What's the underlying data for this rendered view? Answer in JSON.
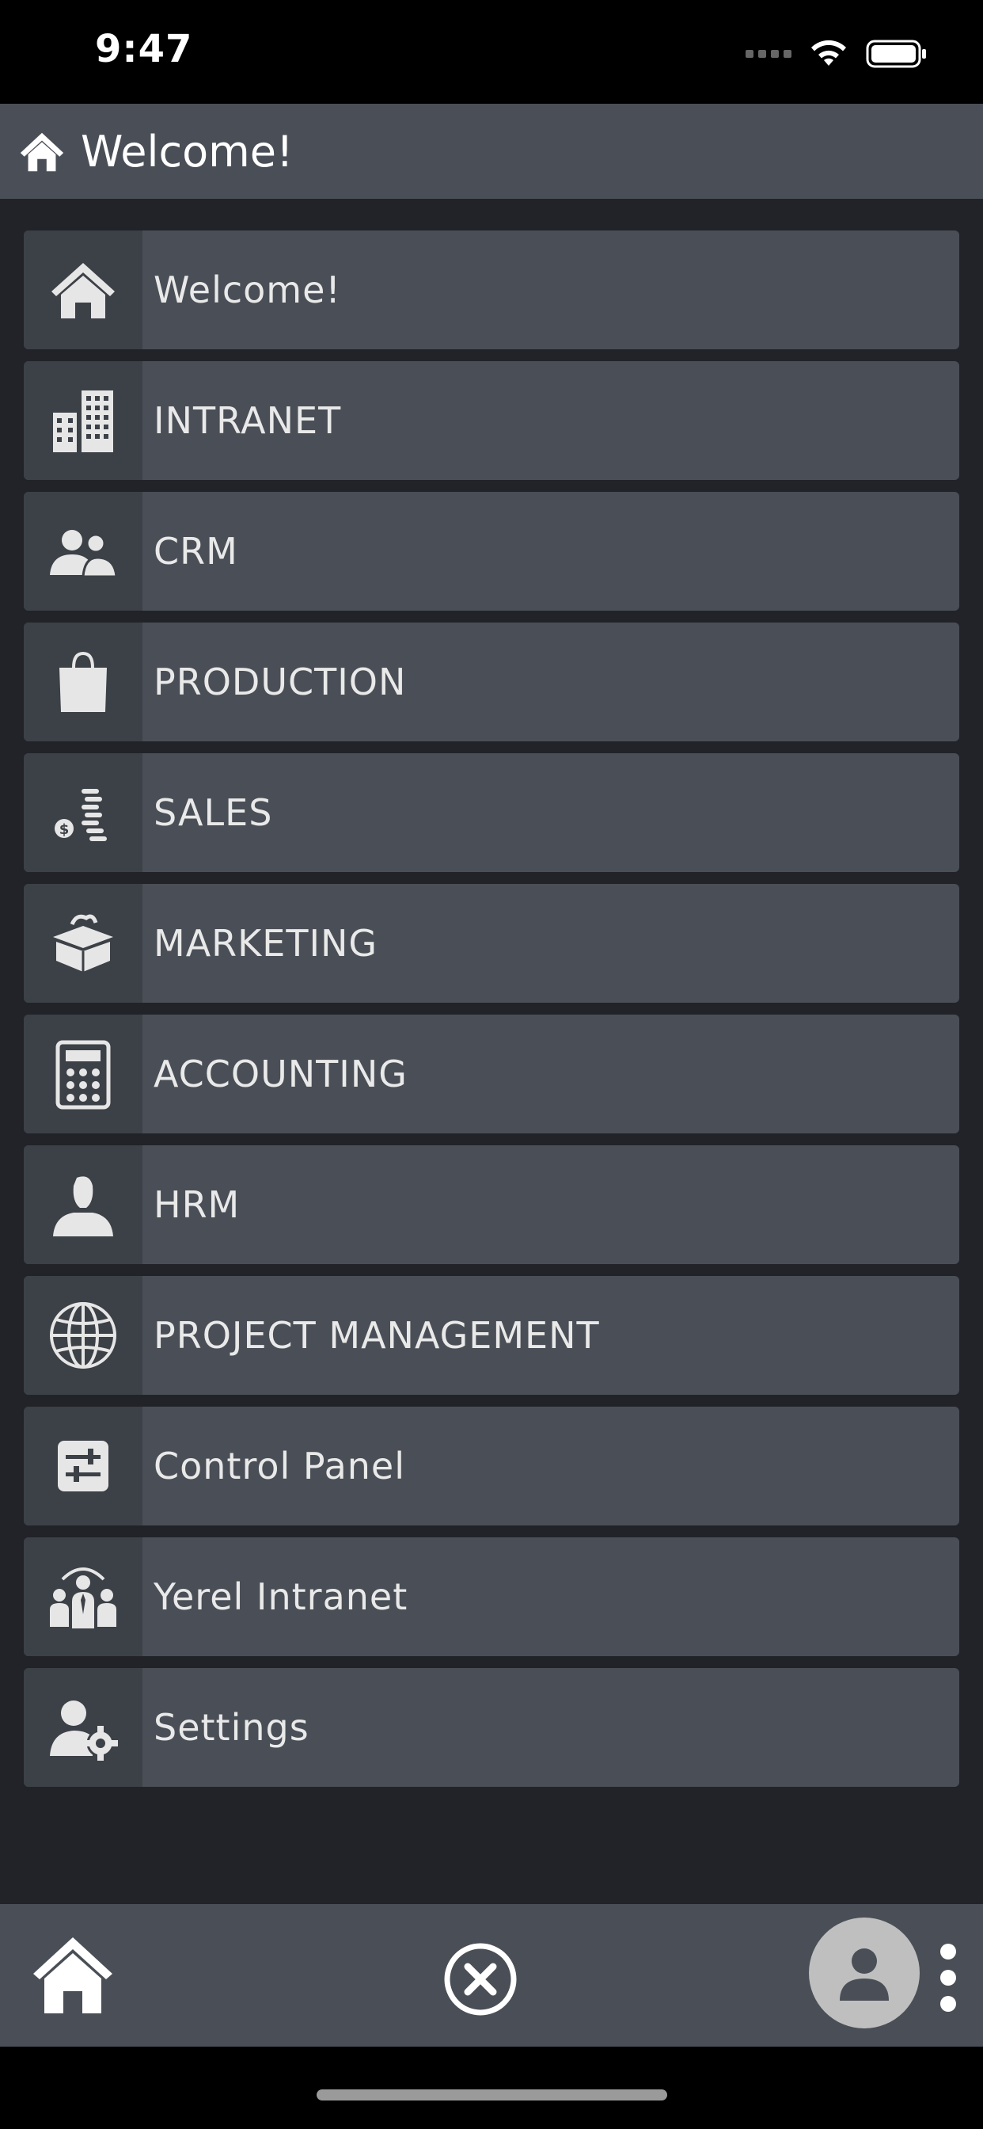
{
  "status_bar": {
    "time": "9:47"
  },
  "header": {
    "title": "Welcome!",
    "icon": "home-icon"
  },
  "menu": {
    "items": [
      {
        "label": "Welcome!",
        "icon": "home-icon"
      },
      {
        "label": "INTRANET",
        "icon": "buildings-icon"
      },
      {
        "label": "CRM",
        "icon": "people-icon"
      },
      {
        "label": "PRODUCTION",
        "icon": "shopping-bag-icon"
      },
      {
        "label": "SALES",
        "icon": "coins-icon"
      },
      {
        "label": "MARKETING",
        "icon": "open-box-icon"
      },
      {
        "label": "ACCOUNTING",
        "icon": "calculator-icon"
      },
      {
        "label": "HRM",
        "icon": "person-icon"
      },
      {
        "label": "PROJECT MANAGEMENT",
        "icon": "globe-icon"
      },
      {
        "label": "Control Panel",
        "icon": "sliders-icon"
      },
      {
        "label": "Yerel Intranet",
        "icon": "team-icon"
      },
      {
        "label": "Settings",
        "icon": "user-gear-icon"
      }
    ]
  },
  "bottom_bar": {
    "home_icon": "home-icon",
    "close_icon": "close-circle-icon",
    "avatar_icon": "avatar-icon",
    "more_icon": "kebab-menu-icon"
  },
  "colors": {
    "header_bg": "#4a4f57",
    "main_bg": "#212328",
    "item_bg": "#4a4f57",
    "icon_bg": "#3c4047",
    "icon_fill": "#e6e6e6"
  }
}
